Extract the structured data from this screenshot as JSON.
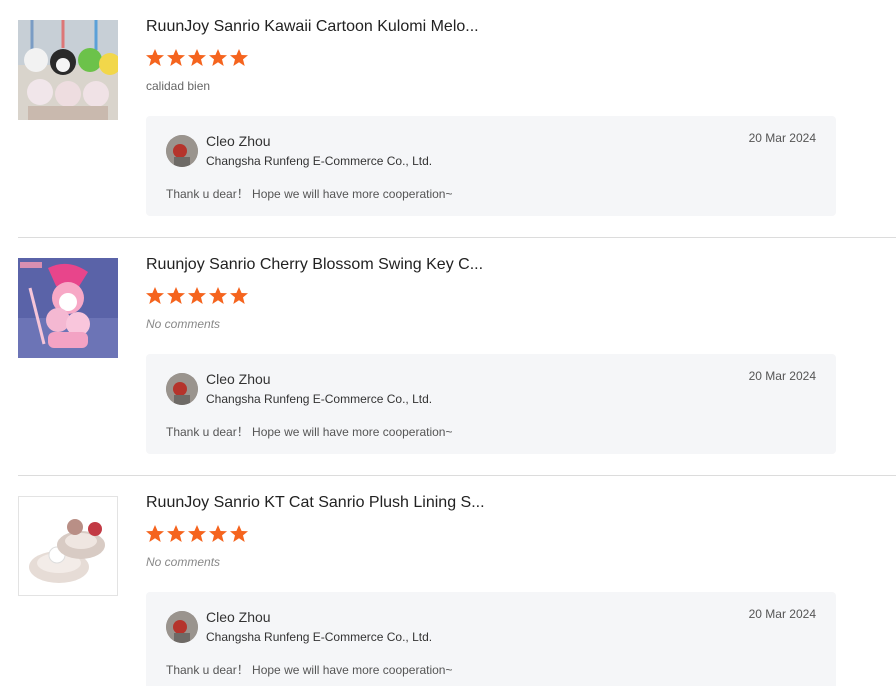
{
  "reviews": [
    {
      "product_title": "RuunJoy Sanrio Kawaii Cartoon Kulomi Melo...",
      "rating": 5,
      "comment": "calidad bien",
      "reply": {
        "name": "Cleo Zhou",
        "company": "Changsha Runfeng E-Commerce Co., Ltd.",
        "date": "20 Mar 2024",
        "text": "Thank u dear！ Hope we will have more cooperation~"
      }
    },
    {
      "product_title": "Ruunjoy Sanrio Cherry Blossom Swing Key C...",
      "rating": 5,
      "comment": "No comments",
      "reply": {
        "name": "Cleo Zhou",
        "company": "Changsha Runfeng E-Commerce Co., Ltd.",
        "date": "20 Mar 2024",
        "text": "Thank u dear！ Hope we will have more cooperation~"
      }
    },
    {
      "product_title": "RuunJoy Sanrio KT Cat Sanrio Plush Lining S...",
      "rating": 5,
      "comment": "No comments",
      "reply": {
        "name": "Cleo Zhou",
        "company": "Changsha Runfeng E-Commerce Co., Ltd.",
        "date": "20 Mar 2024",
        "text": "Thank u dear！ Hope we will have more cooperation~"
      }
    }
  ],
  "colors": {
    "star": "#f5641e",
    "reply_bg": "#f5f6f8",
    "divider": "#dcdcdc"
  },
  "icons": {
    "star": "star-icon"
  }
}
